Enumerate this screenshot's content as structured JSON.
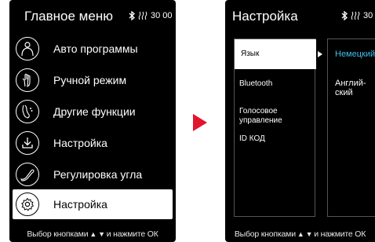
{
  "left_screen": {
    "title": "Главное меню",
    "status": {
      "time": "30 00",
      "icons": [
        "bluetooth-icon",
        "heat-waves-icon"
      ]
    },
    "menu": [
      {
        "label": "Авто программы",
        "icon": "body-outline-icon",
        "selected": false
      },
      {
        "label": "Ручной режим",
        "icon": "hand-icon",
        "selected": false
      },
      {
        "label": "Другие функции",
        "icon": "foot-icon",
        "selected": false
      },
      {
        "label": "Настройка",
        "icon": "download-icon",
        "selected": false
      },
      {
        "label": "Регулировка угла",
        "icon": "chair-icon",
        "selected": false
      },
      {
        "label": "Настройка",
        "icon": "gear-icon",
        "selected": true
      }
    ],
    "footer": {
      "text_before": "Выбор кнопками",
      "text_after": "и нажмите ОК"
    }
  },
  "transition_arrow": {
    "color": "#e2142d"
  },
  "right_screen": {
    "title": "Настройка",
    "status": {
      "time": "30",
      "icons": [
        "bluetooth-icon",
        "heat-waves-icon"
      ]
    },
    "settings": [
      {
        "label": "Язык",
        "selected": true
      },
      {
        "label": "Bluetooth",
        "selected": false
      },
      {
        "label": "Голосовое управление",
        "selected": false
      },
      {
        "label": "ID КОД",
        "selected": false
      }
    ],
    "values": [
      {
        "label": "Немецкий",
        "active": true
      },
      {
        "label": "Англий-ский",
        "active": false
      }
    ],
    "footer": {
      "text_before": "Выбор кнопками",
      "text_after": "и нажмите ОК"
    }
  },
  "colors": {
    "background": "#000000",
    "highlight": "#ffffff",
    "accent": "#3fc0e8",
    "arrow": "#e2142d"
  }
}
